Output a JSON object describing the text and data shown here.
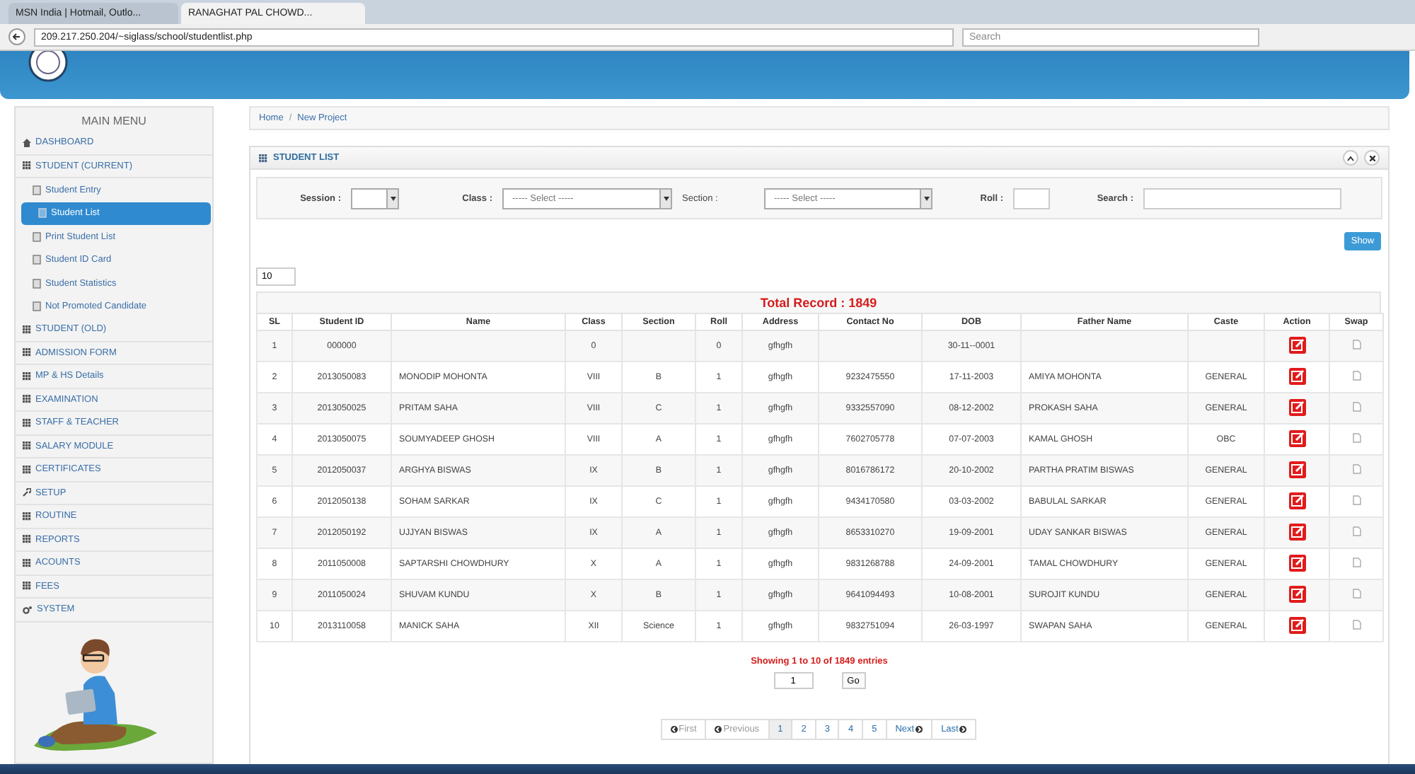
{
  "browser": {
    "tabs": [
      {
        "title": "MSN India | Hotmail, Outlo...",
        "selected": false
      },
      {
        "title": "RANAGHAT PAL CHOWD...",
        "selected": true
      }
    ],
    "address": "209.217.250.204/~siglass/school/studentlist.php",
    "search_placeholder": "Search"
  },
  "breadcrumb": {
    "items": [
      "Home",
      "New Project"
    ],
    "separator": "/"
  },
  "menu": {
    "title": "MAIN MENU",
    "items": [
      {
        "label": "DASHBOARD",
        "kind": "home",
        "selected": false
      },
      {
        "label": "STUDENT (CURRENT)",
        "kind": "group",
        "selected": false
      },
      {
        "label": "Student Entry",
        "kind": "sub",
        "selected": false
      },
      {
        "label": "Student List",
        "kind": "sub",
        "selected": true
      },
      {
        "label": "Print Student List",
        "kind": "sub",
        "selected": false
      },
      {
        "label": "Student ID Card",
        "kind": "sub",
        "selected": false
      },
      {
        "label": "Student Statistics",
        "kind": "sub",
        "selected": false
      },
      {
        "label": "Not Promoted Candidate",
        "kind": "sub",
        "selected": false
      },
      {
        "label": "STUDENT (OLD)",
        "kind": "group",
        "selected": false
      },
      {
        "label": "ADMISSION FORM",
        "kind": "group",
        "selected": false
      },
      {
        "label": "MP & HS Details",
        "kind": "group",
        "selected": false
      },
      {
        "label": "EXAMINATION",
        "kind": "group",
        "selected": false
      },
      {
        "label": "STAFF & TEACHER",
        "kind": "group",
        "selected": false
      },
      {
        "label": "SALARY MODULE",
        "kind": "group",
        "selected": false
      },
      {
        "label": "CERTIFICATES",
        "kind": "group",
        "selected": false
      },
      {
        "label": "SETUP",
        "kind": "tool",
        "selected": false
      },
      {
        "label": "ROUTINE",
        "kind": "group",
        "selected": false
      },
      {
        "label": "REPORTS",
        "kind": "group",
        "selected": false
      },
      {
        "label": "ACOUNTS",
        "kind": "group",
        "selected": false
      },
      {
        "label": "FEES",
        "kind": "group",
        "selected": false
      },
      {
        "label": "SYSTEM",
        "kind": "system",
        "selected": false
      }
    ]
  },
  "panel": {
    "title": "STUDENT LIST",
    "filters": [
      {
        "label": "Session :",
        "kind": "select"
      },
      {
        "label": "Class :",
        "kind": "select",
        "value": "----- Select -----"
      },
      {
        "label": "Section :",
        "kind": "select",
        "value": "----- Select -----"
      },
      {
        "label": "Roll :",
        "kind": "input"
      },
      {
        "label": "Search :",
        "kind": "input"
      }
    ],
    "show_button": "Show",
    "page_size": "10",
    "total": "Total Record : 1849",
    "columns": [
      {
        "label": "SL",
        "kind": "text"
      },
      {
        "label": "Student ID",
        "kind": "text"
      },
      {
        "label": "Name",
        "kind": "text"
      },
      {
        "label": "Class",
        "kind": "text"
      },
      {
        "label": "Section",
        "kind": "text"
      },
      {
        "label": "Roll",
        "kind": "text"
      },
      {
        "label": "Address",
        "kind": "text"
      },
      {
        "label": "Contact No",
        "kind": "text"
      },
      {
        "label": "DOB",
        "kind": "text"
      },
      {
        "label": "Father Name",
        "kind": "text"
      },
      {
        "label": "Caste",
        "kind": "text"
      },
      {
        "label": "Action",
        "kind": "action"
      },
      {
        "label": "Swap",
        "kind": "swap"
      }
    ],
    "rows": [
      [
        "1",
        "000000",
        null,
        "0",
        null,
        "0",
        "gfhgfh",
        null,
        "30-11--0001",
        null,
        null
      ],
      [
        "2",
        "2013050083",
        "MONODIP MOHONTA",
        "VIII",
        "B",
        "1",
        "gfhgfh",
        "9232475550",
        "17-11-2003",
        "AMIYA MOHONTA",
        "GENERAL"
      ],
      [
        "3",
        "2013050025",
        "PRITAM SAHA",
        "VIII",
        "C",
        "1",
        "gfhgfh",
        "9332557090",
        "08-12-2002",
        "PROKASH SAHA",
        "GENERAL"
      ],
      [
        "4",
        "2013050075",
        "SOUMYADEEP GHOSH",
        "VIII",
        "A",
        "1",
        "gfhgfh",
        "7602705778",
        "07-07-2003",
        "KAMAL GHOSH",
        "OBC"
      ],
      [
        "5",
        "2012050037",
        "ARGHYA BISWAS",
        "IX",
        "B",
        "1",
        "gfhgfh",
        "8016786172",
        "20-10-2002",
        "PARTHA PRATIM BISWAS",
        "GENERAL"
      ],
      [
        "6",
        "2012050138",
        "SOHAM SARKAR",
        "IX",
        "C",
        "1",
        "gfhgfh",
        "9434170580",
        "03-03-2002",
        "BABULAL SARKAR",
        "GENERAL"
      ],
      [
        "7",
        "2012050192",
        "UJJYAN BISWAS",
        "IX",
        "A",
        "1",
        "gfhgfh",
        "8653310270",
        "19-09-2001",
        "UDAY SANKAR BISWAS",
        "GENERAL"
      ],
      [
        "8",
        "2011050008",
        "SAPTARSHI CHOWDHURY",
        "X",
        "A",
        "1",
        "gfhgfh",
        "9831268788",
        "24-09-2001",
        "TAMAL CHOWDHURY",
        "GENERAL"
      ],
      [
        "9",
        "2011050024",
        "SHUVAM KUNDU",
        "X",
        "B",
        "1",
        "gfhgfh",
        "9641094493",
        "10-08-2001",
        "SUROJIT KUNDU",
        "GENERAL"
      ],
      [
        "10",
        "2013110058",
        "MANICK SAHA",
        "XII",
        "Science",
        "1",
        "gfhgfh",
        "9832751094",
        "26-03-1997",
        "SWAPAN SAHA",
        "GENERAL"
      ]
    ],
    "showing": "Showing 1 to 10 of 1849 entries",
    "page_input": "1",
    "go_button": "Go",
    "pagination": [
      {
        "label": "First",
        "kind": "first",
        "selected": false,
        "disabled": true
      },
      {
        "label": "Previous",
        "kind": "prev",
        "selected": false,
        "disabled": true
      },
      {
        "label": "1",
        "kind": "page",
        "selected": true,
        "disabled": false
      },
      {
        "label": "2",
        "kind": "page",
        "selected": false,
        "disabled": false
      },
      {
        "label": "3",
        "kind": "page",
        "selected": false,
        "disabled": false
      },
      {
        "label": "4",
        "kind": "page",
        "selected": false,
        "disabled": false
      },
      {
        "label": "5",
        "kind": "page",
        "selected": false,
        "disabled": false
      },
      {
        "label": "Next",
        "kind": "next",
        "selected": false,
        "disabled": false
      },
      {
        "label": "Last",
        "kind": "last",
        "selected": false,
        "disabled": false
      }
    ]
  }
}
